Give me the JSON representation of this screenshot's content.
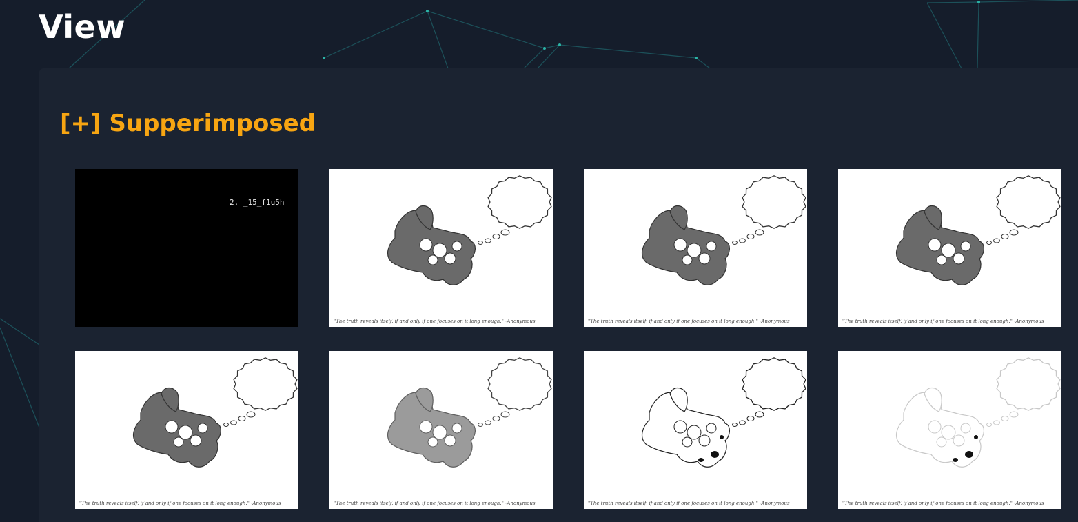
{
  "page": {
    "title": "View"
  },
  "section": {
    "title": "[+] Supperimposed"
  },
  "images": [
    {
      "style": "dark",
      "label": "2. _15_f1u5h"
    },
    {
      "style": "light",
      "variant": "full",
      "caption": "\"The truth reveals itself, if and only if one focuses on it long enough.\" -Anonymous"
    },
    {
      "style": "light",
      "variant": "full",
      "caption": "\"The truth reveals itself, if and only if one focuses on it long enough.\" -Anonymous"
    },
    {
      "style": "light",
      "variant": "full",
      "caption": "\"The truth reveals itself, if and only if one focuses on it long enough.\" -Anonymous"
    },
    {
      "style": "light",
      "variant": "full",
      "caption": "\"The truth reveals itself, if and only if one focuses on it long enough.\" -Anonymous"
    },
    {
      "style": "light",
      "variant": "medium",
      "caption": "\"The truth reveals itself, if and only if one focuses on it long enough.\" -Anonymous"
    },
    {
      "style": "light",
      "variant": "light",
      "caption": "\"The truth reveals itself, if and only if one focuses on it long enough.\" -Anonymous"
    },
    {
      "style": "light",
      "variant": "faint",
      "caption": "\"The truth reveals itself, if and only if one focuses on it long enough.\" -Anonymous"
    }
  ]
}
